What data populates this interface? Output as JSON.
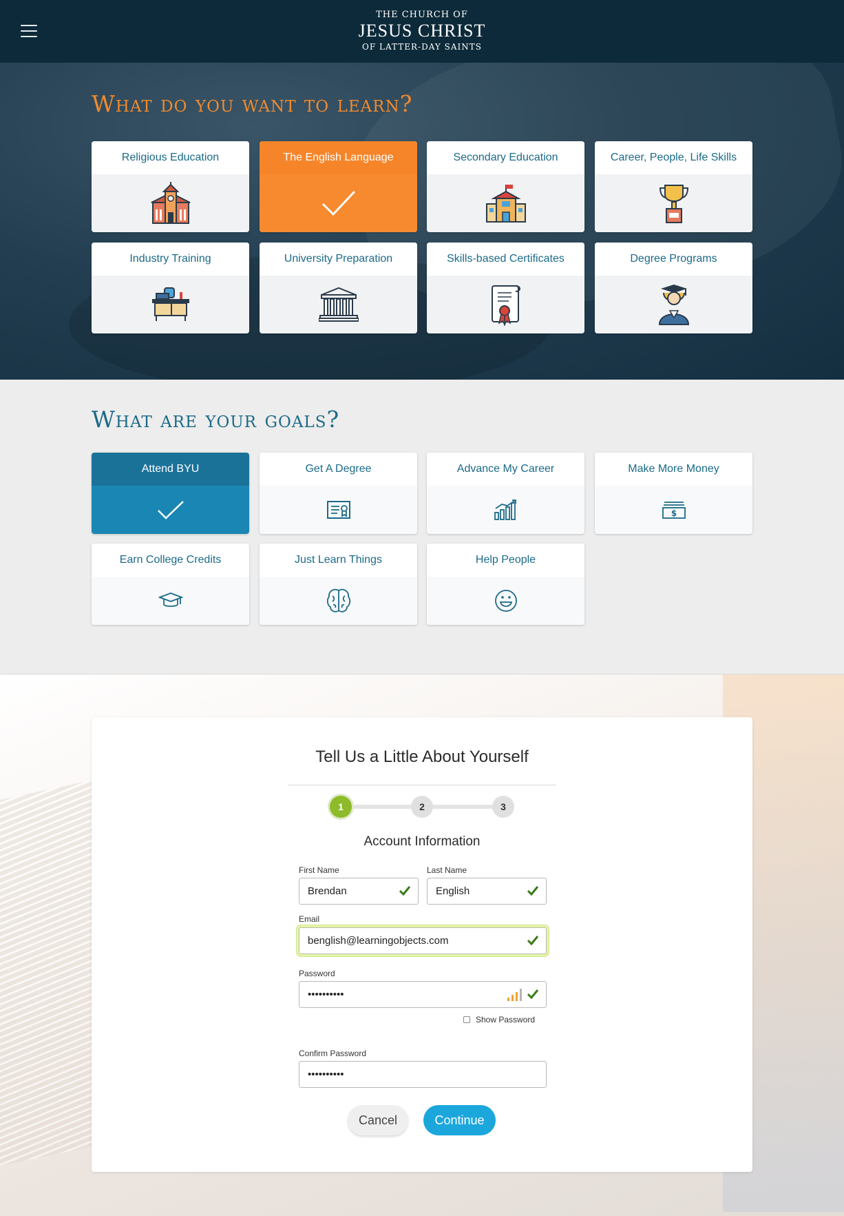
{
  "header": {
    "logo_line1": "THE CHURCH OF",
    "logo_line2": "JESUS CHRIST",
    "logo_line3": "OF LATTER-DAY SAINTS",
    "menu_icon": "hamburger-icon"
  },
  "learn": {
    "title": "What do you want to learn?",
    "options": [
      {
        "label": "Religious Education",
        "icon": "church-icon",
        "selected": false
      },
      {
        "label": "The English Language",
        "icon": "check-icon",
        "selected": true
      },
      {
        "label": "Secondary Education",
        "icon": "school-icon",
        "selected": false
      },
      {
        "label": "Career, People, Life Skills",
        "icon": "trophy-icon",
        "selected": false
      },
      {
        "label": "Industry Training",
        "icon": "desk-icon",
        "selected": false
      },
      {
        "label": "University Preparation",
        "icon": "columns-building-icon",
        "selected": false
      },
      {
        "label": "Skills-based Certificates",
        "icon": "certificate-icon",
        "selected": false
      },
      {
        "label": "Degree Programs",
        "icon": "graduate-icon",
        "selected": false
      }
    ]
  },
  "goals": {
    "title": "What are your goals?",
    "options": [
      {
        "label": "Attend BYU",
        "icon": "check-icon",
        "selected": true
      },
      {
        "label": "Get A Degree",
        "icon": "diploma-icon",
        "selected": false
      },
      {
        "label": "Advance My Career",
        "icon": "growth-chart-icon",
        "selected": false
      },
      {
        "label": "Make More Money",
        "icon": "money-icon",
        "selected": false
      },
      {
        "label": "Earn College Credits",
        "icon": "mortarboard-icon",
        "selected": false
      },
      {
        "label": "Just Learn Things",
        "icon": "brain-icon",
        "selected": false
      },
      {
        "label": "Help People",
        "icon": "smiley-icon",
        "selected": false
      }
    ]
  },
  "form": {
    "title": "Tell Us a Little About Yourself",
    "steps": [
      "1",
      "2",
      "3"
    ],
    "active_step": "1",
    "subtitle": "Account Information",
    "first_name_label": "First Name",
    "first_name_value": "Brendan",
    "last_name_label": "Last Name",
    "last_name_value": "English",
    "email_label": "Email",
    "email_value": "benglish@learningobjects.com",
    "password_label": "Password",
    "password_value": "••••••••••",
    "show_password_label": "Show Password",
    "confirm_label": "Confirm Password",
    "confirm_value": "••••••••••",
    "cancel_label": "Cancel",
    "continue_label": "Continue"
  },
  "colors": {
    "accent_orange": "#f6852a",
    "accent_blue": "#1a86b3",
    "check_green": "#3b7a17",
    "continue_blue": "#1ba6dc"
  }
}
